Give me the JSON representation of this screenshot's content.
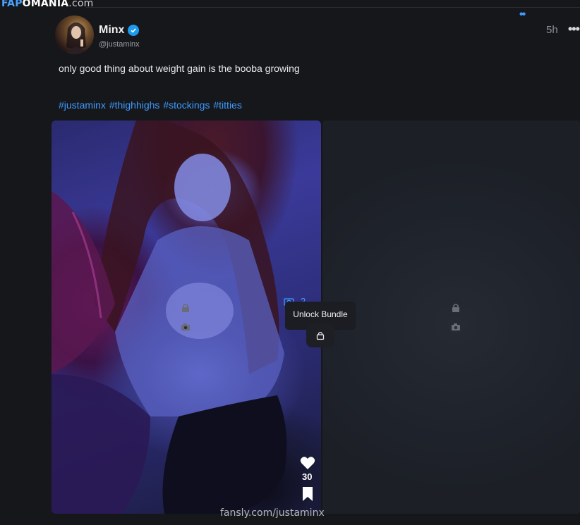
{
  "site": {
    "logo_part1": "FAP",
    "logo_part2": "OMANIA",
    "logo_part3": ".com"
  },
  "post": {
    "author_name": "Minx",
    "handle": "@justaminx",
    "time": "5h",
    "more_label": "•••",
    "text": "only good thing about weight gain is the booba growing",
    "tags": [
      "#justaminx",
      "#thighhighs",
      "#stockings",
      "#titties"
    ]
  },
  "media": {
    "bundle_count": "2",
    "tooltip": "Unlock Bundle",
    "likes": "30",
    "watermark": "fansly.com/justaminx",
    "panel_more": "••"
  },
  "colors": {
    "accent": "#3d9bff",
    "verified": "#1d9bf0",
    "background": "#16171b"
  },
  "icons": [
    "verified-badge-icon",
    "more-icon",
    "lock-icon",
    "camera-icon",
    "heart-icon",
    "bookmark-icon"
  ]
}
